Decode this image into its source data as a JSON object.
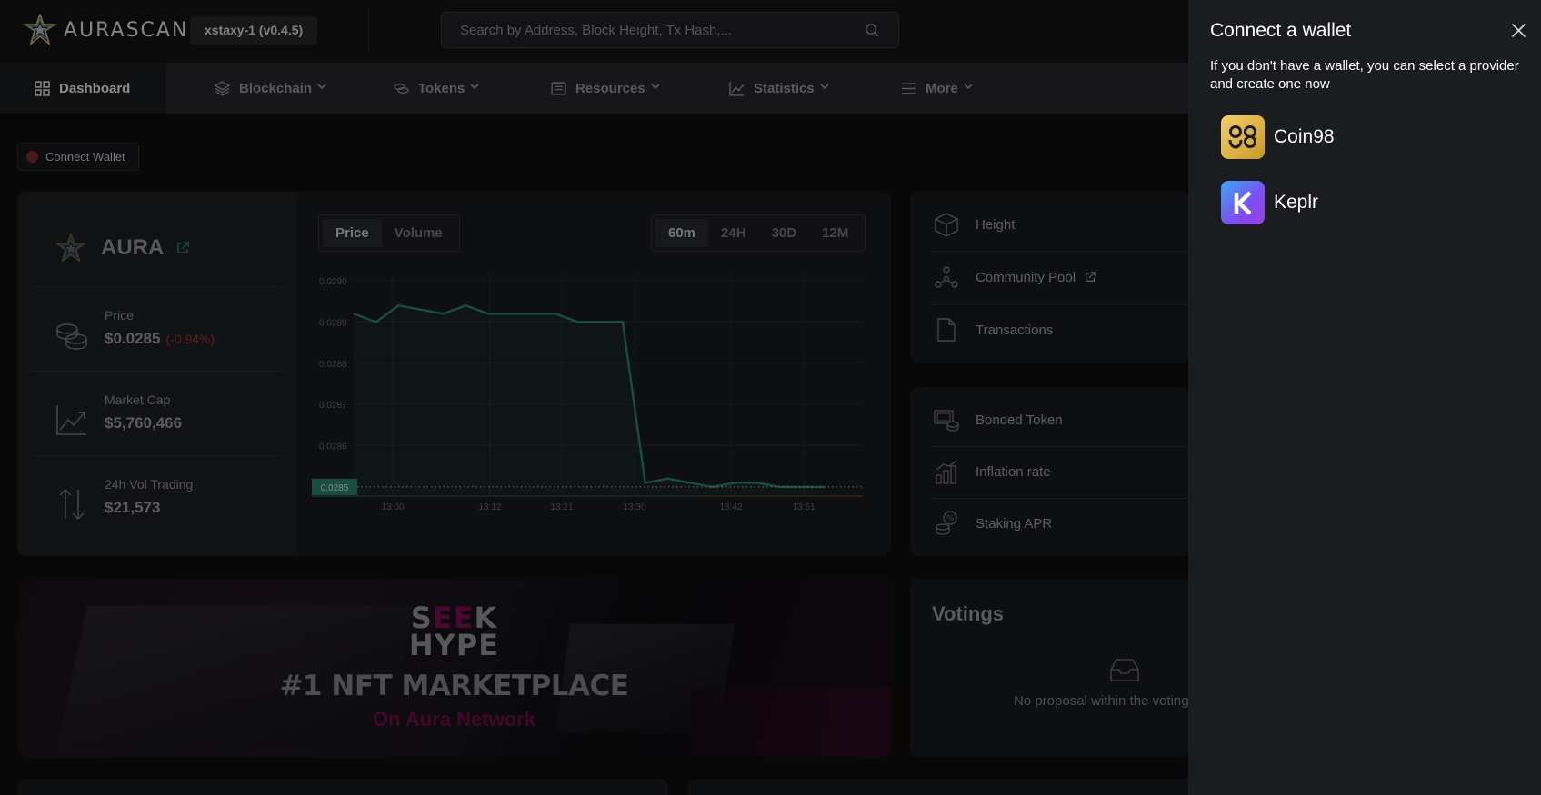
{
  "header": {
    "brand": "AURASCAN",
    "network": "xstaxy-1 (v0.4.5)",
    "search_placeholder": "Search by Address, Block Height, Tx Hash,..."
  },
  "nav": [
    {
      "label": "Dashboard",
      "icon": "grid-icon",
      "active": true
    },
    {
      "label": "Blockchain",
      "icon": "layers-icon"
    },
    {
      "label": "Tokens",
      "icon": "coins-icon"
    },
    {
      "label": "Resources",
      "icon": "newspaper-icon"
    },
    {
      "label": "Statistics",
      "icon": "line-chart-icon"
    },
    {
      "label": "More",
      "icon": "menu-icon"
    }
  ],
  "connect_wallet_chip": "Connect Wallet",
  "token": {
    "name": "AURA",
    "price_label": "Price",
    "price": "$0.0285",
    "price_change": "(-0.94%)",
    "market_cap_label": "Market Cap",
    "market_cap": "$5,760,466",
    "vol_label": "24h Vol Trading",
    "vol": "$21,573"
  },
  "chart_tabs": {
    "type": [
      "Price",
      "Volume"
    ],
    "type_selected": "Price",
    "range": [
      "60m",
      "24H",
      "30D",
      "12M"
    ],
    "range_selected": "60m"
  },
  "chart_data": {
    "type": "area",
    "title": "",
    "xlabel": "",
    "ylabel": "",
    "y_ticks": [
      "0.0290",
      "0.0289",
      "0.0288",
      "0.0287",
      "0.0286"
    ],
    "x_ticks": [
      "13:00",
      "13:12",
      "13:21",
      "13:30",
      "13:42",
      "13:51"
    ],
    "ylim": [
      0.02848,
      0.029
    ],
    "current_value_label": "0.0285",
    "series": [
      {
        "values": [
          0.02892,
          0.0289,
          0.02894,
          0.02893,
          0.02892,
          0.02894,
          0.02892,
          0.02892,
          0.02892,
          0.02892,
          0.0289,
          0.0289,
          0.0289,
          0.02851,
          0.02852,
          0.02851,
          0.0285,
          0.02851,
          0.02851,
          0.0285,
          0.0285,
          0.0285
        ],
        "color": "#2e8e74"
      }
    ]
  },
  "info": {
    "height_label": "Height",
    "community_pool_label": "Community Pool",
    "transactions_label": "Transactions",
    "bonded_token_label": "Bonded Token",
    "inflation_label": "Inflation rate",
    "staking_apr_label": "Staking APR"
  },
  "banner": {
    "logo_line1_prefix": "S",
    "logo_line1_highlight": "EE",
    "logo_line1_suffix": "K",
    "logo_line2": "HYPE",
    "title": "#1 NFT MARKETPLACE",
    "subtitle": "On Aura Network"
  },
  "votings": {
    "title": "Votings",
    "empty": "No proposal within the voting"
  },
  "drawer": {
    "title": "Connect a wallet",
    "description": "If you don't have a wallet, you can select a provider and create one now",
    "wallets": [
      "Coin98",
      "Keplr"
    ]
  }
}
